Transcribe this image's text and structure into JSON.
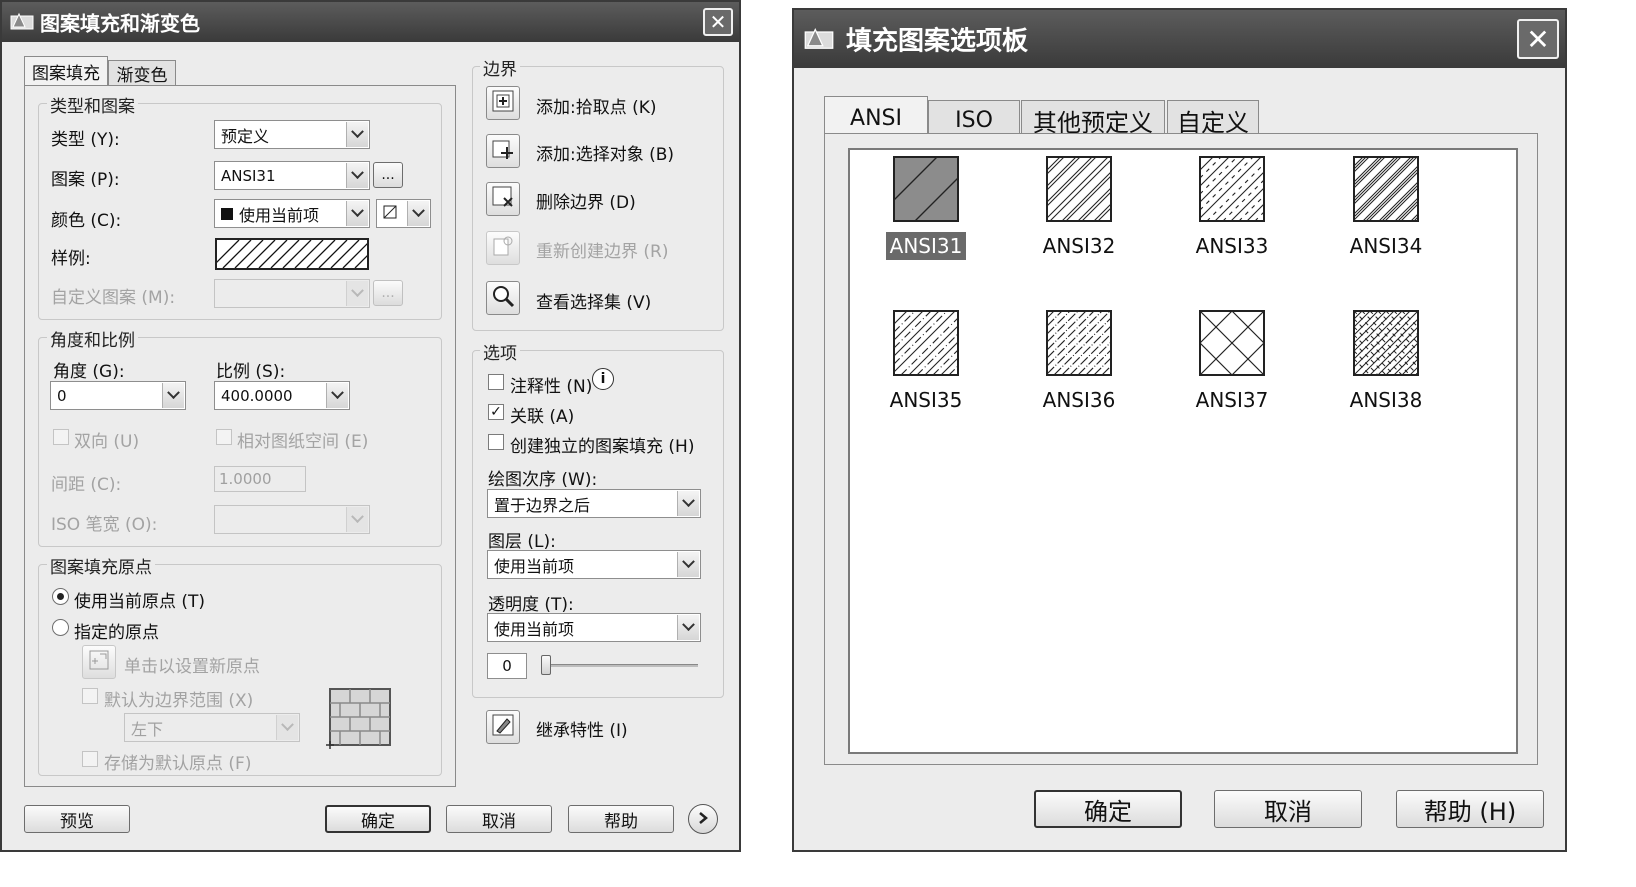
{
  "dialog1": {
    "title": "图案填充和渐变色",
    "tabs": [
      "图案填充",
      "渐变色"
    ],
    "type_pattern_group": {
      "title": "类型和图案",
      "type_label": "类型 (Y):",
      "type_value": "预定义",
      "pattern_label": "图案 (P):",
      "pattern_value": "ANSI31",
      "browse_label": "...",
      "color_label": "颜色 (C):",
      "color_value": "使用当前项",
      "swatch_label": "样例:",
      "custom_label": "自定义图案 (M):"
    },
    "angle_scale_group": {
      "title": "角度和比例",
      "angle_label": "角度 (G):",
      "angle_value": "0",
      "scale_label": "比例 (S):",
      "scale_value": "400.0000",
      "double_label": "双向 (U)",
      "relative_label": "相对图纸空间 (E)",
      "spacing_label": "间距 (C):",
      "spacing_value": "1.0000",
      "iso_label": "ISO 笔宽 (O):"
    },
    "origin_group": {
      "title": "图案填充原点",
      "use_current_label": "使用当前原点 (T)",
      "specify_label": "指定的原点",
      "click_set_label": "单击以设置新原点",
      "default_extent_label": "默认为边界范围 (X)",
      "extent_value": "左下",
      "store_default_label": "存储为默认原点 (F)"
    },
    "boundary_group": {
      "title": "边界",
      "add_pick_label": "添加:拾取点 (K)",
      "add_select_label": "添加:选择对象 (B)",
      "remove_label": "删除边界 (D)",
      "recreate_label": "重新创建边界 (R)",
      "view_label": "查看选择集 (V)"
    },
    "options_group": {
      "title": "选项",
      "annotative_label": "注释性 (N)",
      "associative_label": "关联 (A)",
      "separate_label": "创建独立的图案填充 (H)",
      "draw_order_label": "绘图次序 (W):",
      "draw_order_value": "置于边界之后",
      "layer_label": "图层 (L):",
      "layer_value": "使用当前项",
      "transparency_label": "透明度 (T):",
      "transparency_value": "使用当前项",
      "transparency_amount": "0"
    },
    "inherit_label": "继承特性 (I)",
    "buttons": {
      "preview": "预览",
      "ok": "确定",
      "cancel": "取消",
      "help": "帮助"
    }
  },
  "dialog2": {
    "title": "填充图案选项板",
    "tabs": [
      "ANSI",
      "ISO",
      "其他预定义",
      "自定义"
    ],
    "patterns": [
      "ANSI31",
      "ANSI32",
      "ANSI33",
      "ANSI34",
      "ANSI35",
      "ANSI36",
      "ANSI37",
      "ANSI38"
    ],
    "selected_pattern": "ANSI31",
    "buttons": {
      "ok": "确定",
      "cancel": "取消",
      "help": "帮助 (H)"
    }
  }
}
